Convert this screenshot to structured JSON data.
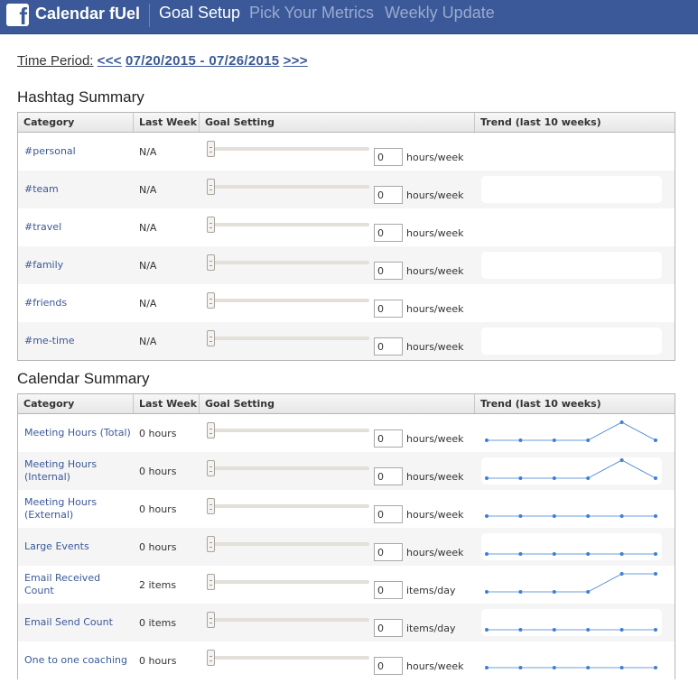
{
  "app": {
    "title": "Calendar fUel",
    "logo_letter": "f",
    "nav": [
      {
        "label": "Goal Setup",
        "active": true
      },
      {
        "label": "Pick Your Metrics",
        "active": false
      },
      {
        "label": "Weekly Update",
        "active": false
      }
    ]
  },
  "time_period": {
    "label": "Time Period:",
    "prev": "<<<",
    "range": "07/20/2015 - 07/26/2015",
    "next": ">>>"
  },
  "columns": {
    "category": "Category",
    "last_week": "Last Week",
    "goal_setting": "Goal Setting",
    "trend": "Trend (last 10 weeks)"
  },
  "hashtag_summary": {
    "title": "Hashtag Summary",
    "rows": [
      {
        "category": "#personal",
        "last_week": "N/A",
        "goal": "0",
        "unit": "hours/week",
        "trend": []
      },
      {
        "category": "#team",
        "last_week": "N/A",
        "goal": "0",
        "unit": "hours/week",
        "trend": []
      },
      {
        "category": "#travel",
        "last_week": "N/A",
        "goal": "0",
        "unit": "hours/week",
        "trend": []
      },
      {
        "category": "#family",
        "last_week": "N/A",
        "goal": "0",
        "unit": "hours/week",
        "trend": []
      },
      {
        "category": "#friends",
        "last_week": "N/A",
        "goal": "0",
        "unit": "hours/week",
        "trend": []
      },
      {
        "category": "#me-time",
        "last_week": "N/A",
        "goal": "0",
        "unit": "hours/week",
        "trend": []
      }
    ]
  },
  "calendar_summary": {
    "title": "Calendar Summary",
    "rows": [
      {
        "category": "Meeting Hours (Total)",
        "last_week": "0 hours",
        "goal": "0",
        "unit": "hours/week",
        "trend": [
          0,
          0,
          0,
          0,
          1,
          0
        ]
      },
      {
        "category": "Meeting Hours (Internal)",
        "last_week": "0 hours",
        "goal": "0",
        "unit": "hours/week",
        "trend": [
          0,
          0,
          0,
          0,
          1,
          0
        ]
      },
      {
        "category": "Meeting Hours (External)",
        "last_week": "0 hours",
        "goal": "0",
        "unit": "hours/week",
        "trend": [
          0,
          0,
          0,
          0,
          0,
          0
        ]
      },
      {
        "category": "Large Events",
        "last_week": "0 hours",
        "goal": "0",
        "unit": "hours/week",
        "trend": [
          0,
          0,
          0,
          0,
          0,
          0
        ]
      },
      {
        "category": "Email Received Count",
        "last_week": "2 items",
        "goal": "0",
        "unit": "items/day",
        "trend": [
          0,
          0,
          0,
          0,
          1,
          1
        ]
      },
      {
        "category": "Email Send Count",
        "last_week": "0 items",
        "goal": "0",
        "unit": "items/day",
        "trend": [
          0,
          0,
          0,
          0,
          0,
          0
        ]
      },
      {
        "category": "One to one coaching",
        "last_week": "0 hours",
        "goal": "0",
        "unit": "hours/week",
        "trend": [
          0,
          0,
          0,
          0,
          0,
          0
        ]
      }
    ]
  },
  "colors": {
    "brand": "#3b5998",
    "trend_line": "#3d7fd4"
  }
}
